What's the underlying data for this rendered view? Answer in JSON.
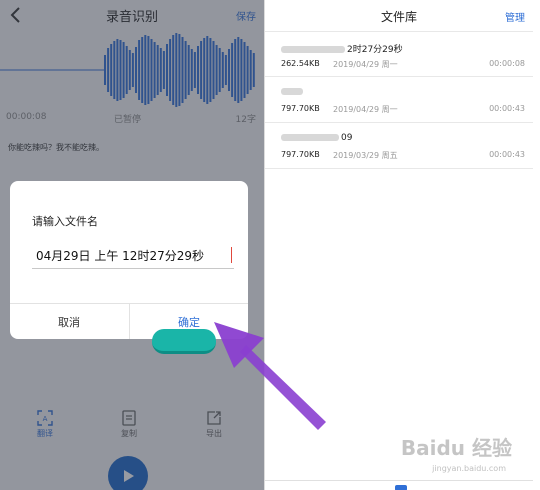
{
  "recorder": {
    "title": "录音识别",
    "save_label": "保存",
    "elapsed": "00:00:08",
    "status": "已暂停",
    "char_count": "12字",
    "transcript": "你能吃辣吗？我不能吃辣。",
    "wave_color": "#2f6fd6",
    "tools": [
      {
        "label": "翻译",
        "icon": "translate-icon"
      },
      {
        "label": "复制",
        "icon": "copy-icon"
      },
      {
        "label": "导出",
        "icon": "export-icon"
      }
    ]
  },
  "dialog": {
    "title": "请输入文件名",
    "input_value": "04月29日 上午 12时27分29秒",
    "cancel_label": "取消",
    "confirm_label": "确定"
  },
  "file_library": {
    "title": "文件库",
    "manage_label": "管理",
    "files": [
      {
        "name_visible": "2时27分29秒",
        "size": "262.54KB",
        "date": "2019/04/29 周一",
        "duration": "00:00:08"
      },
      {
        "name_visible": "",
        "size": "797.70KB",
        "date": "2019/04/29 周一",
        "duration": "00:00:43"
      },
      {
        "name_visible": "09",
        "size": "797.70KB",
        "date": "2019/03/29 周五",
        "duration": "00:00:43"
      }
    ]
  },
  "watermark": {
    "brand": "Baidu 经验",
    "url": "jingyan.baidu.com"
  },
  "colors": {
    "accent": "#2f6fd6",
    "highlight": "#1ab5a8",
    "arrow": "#8a3fd0"
  }
}
